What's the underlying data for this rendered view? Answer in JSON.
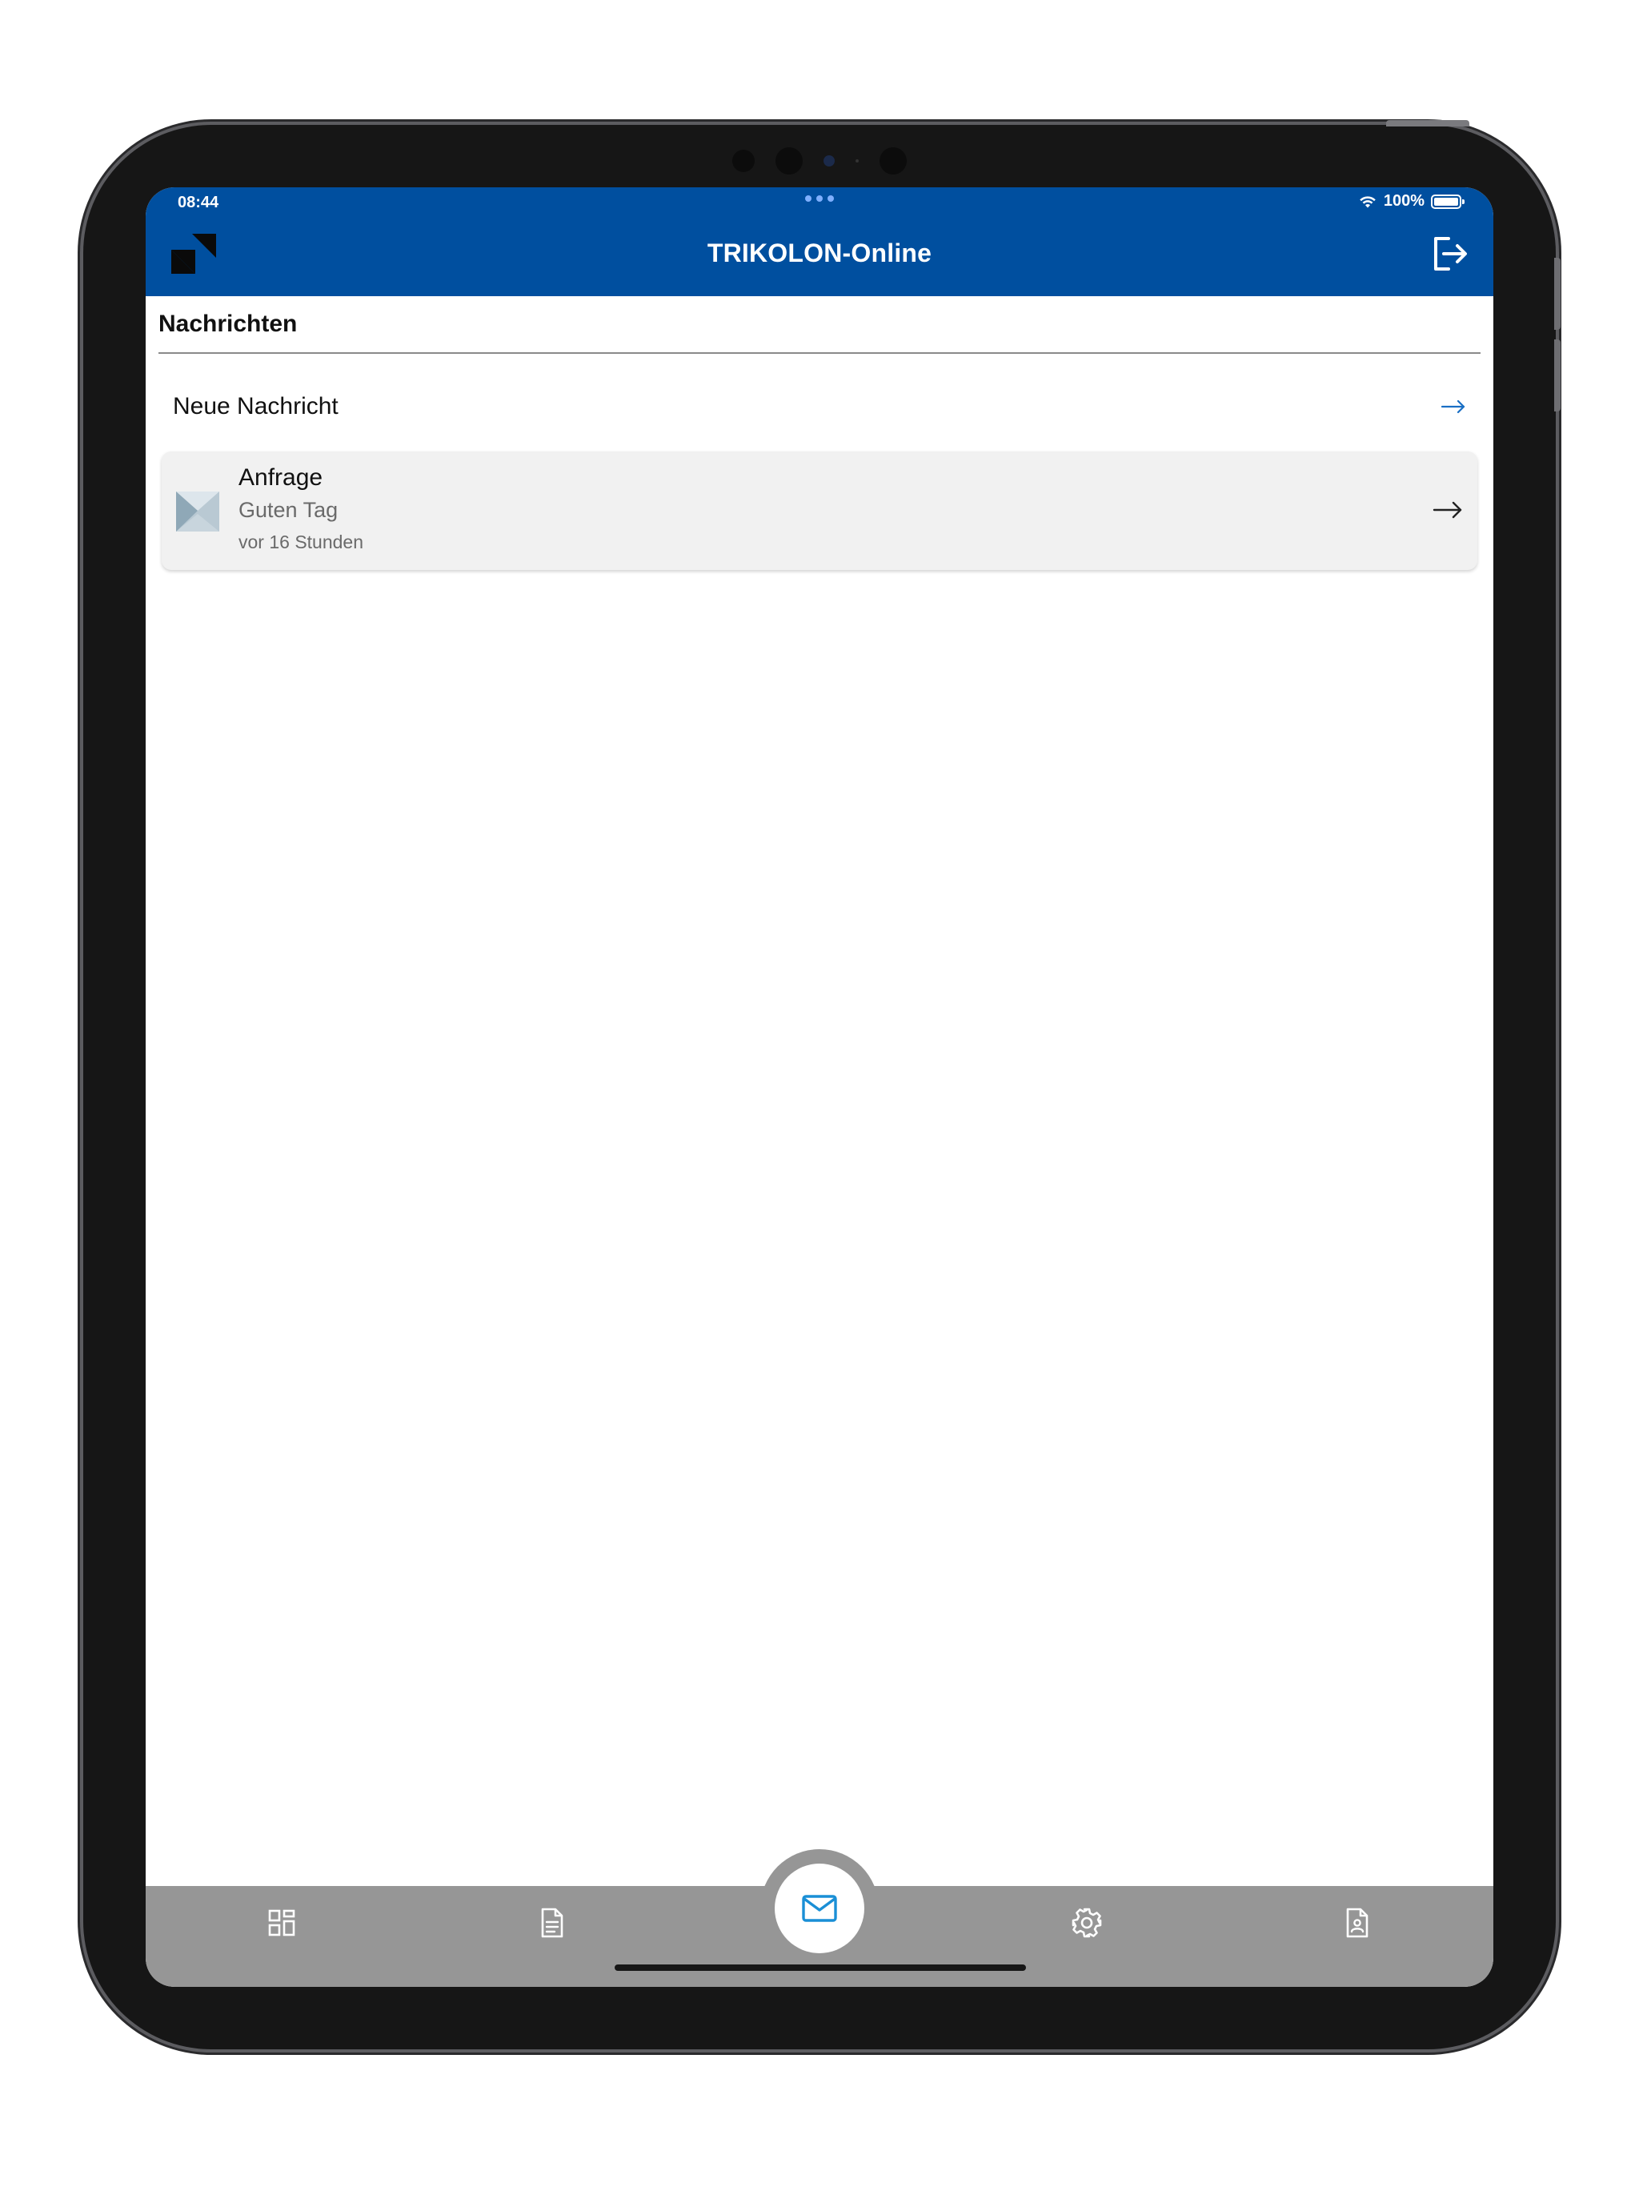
{
  "status_bar": {
    "time": "08:44",
    "battery": "100%"
  },
  "header": {
    "title": "TRIKOLON-Online"
  },
  "content": {
    "section_title": "Nachrichten",
    "new_message_label": "Neue Nachricht"
  },
  "messages": [
    {
      "subject": "Anfrage",
      "preview": "Guten Tag",
      "time": "vor 16 Stunden"
    }
  ],
  "tabbar": {
    "active": "mail-icon",
    "tabs": [
      "dashboard-icon",
      "document-icon",
      "mail-icon",
      "gear-icon",
      "contact-document-icon"
    ]
  },
  "colors": {
    "brand": "#004f9f",
    "accent": "#1a8fd6",
    "tabbar": "#969696"
  }
}
